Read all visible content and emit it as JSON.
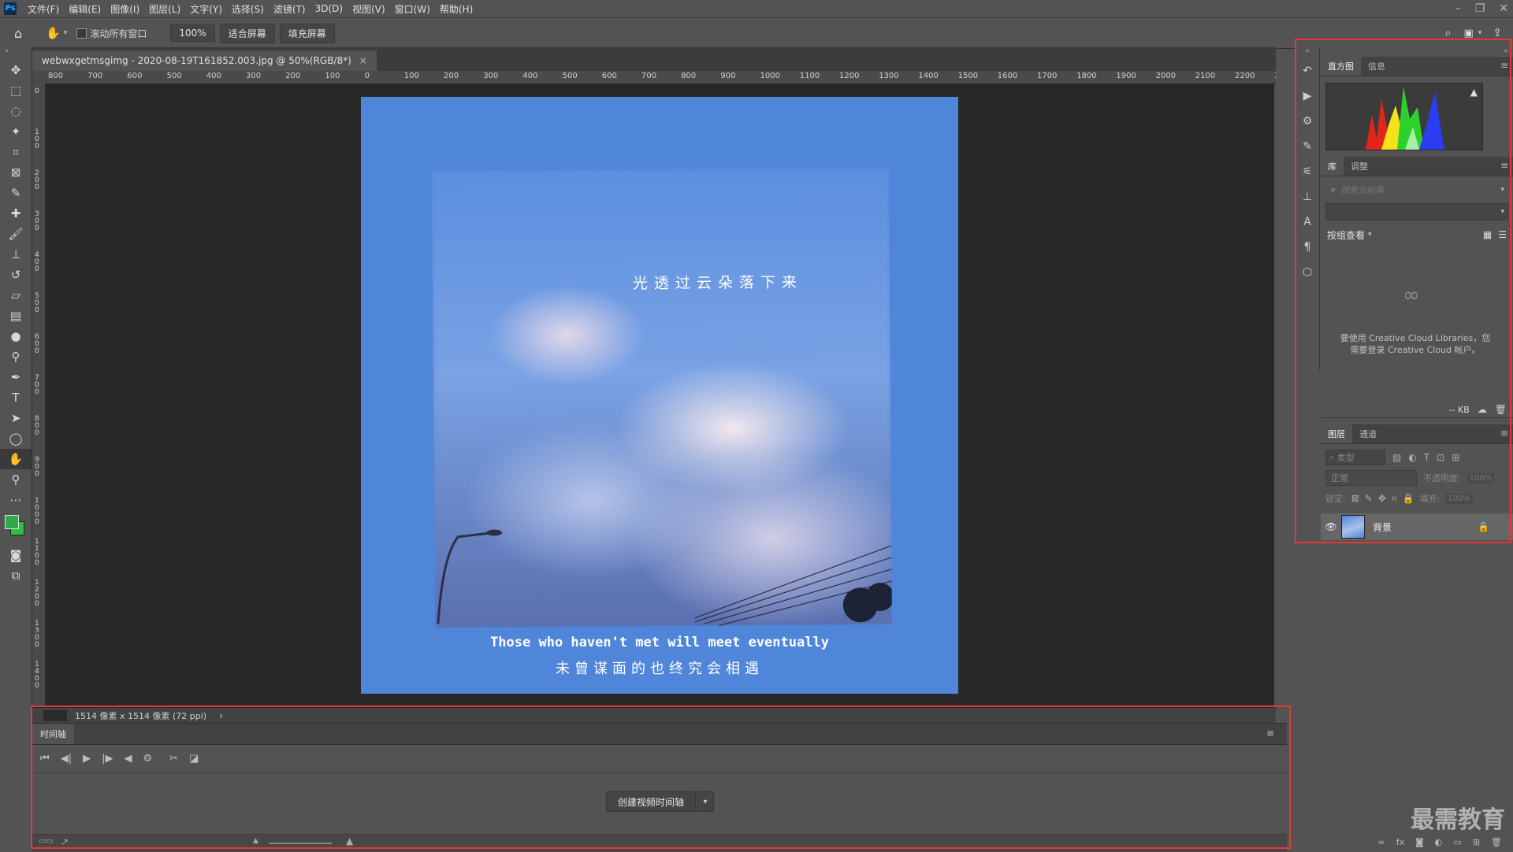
{
  "app": {
    "logo": "Ps"
  },
  "menu": [
    "文件(F)",
    "编辑(E)",
    "图像(I)",
    "图层(L)",
    "文字(Y)",
    "选择(S)",
    "滤镜(T)",
    "3D(D)",
    "视图(V)",
    "窗口(W)",
    "帮助(H)"
  ],
  "window_controls": [
    "–",
    "❐",
    "✕"
  ],
  "options": {
    "scroll_all_label": "滚动所有窗口",
    "zoom_btn": "100%",
    "fit_btn": "适合屏幕",
    "fill_btn": "填充屏幕"
  },
  "tools": [
    "move-tool-icon",
    "marquee-tool-icon",
    "lasso-tool-icon",
    "magic-wand-icon",
    "crop-tool-icon",
    "frame-tool-icon",
    "eyedropper-icon",
    "healing-brush-icon",
    "brush-tool-icon",
    "stamp-tool-icon",
    "history-brush-icon",
    "eraser-icon",
    "gradient-tool-icon",
    "blur-tool-icon",
    "dodge-tool-icon",
    "pen-tool-icon",
    "type-tool-icon",
    "path-select-icon",
    "ellipse-tool-icon",
    "hand-tool-icon",
    "zoom-tool-icon",
    "more-tools-icon"
  ],
  "colors": {
    "foreground": "#2fa84f",
    "background": "#27c43a",
    "highlight": "#e53935",
    "canvas_bg": "#4f86d9"
  },
  "document": {
    "tab_title": "webwxgetmsgimg - 2020-08-19T161852.003.jpg @ 50%(RGB/8*)",
    "tab_close": "×",
    "photo_caption": "光透过云朵落下来",
    "caption_en": "Those who haven't met will meet eventually",
    "caption_cn": "未曾谋面的也终究会相遇"
  },
  "ruler_h": [
    "800",
    "700",
    "600",
    "500",
    "400",
    "300",
    "200",
    "100",
    "0",
    "100",
    "200",
    "300",
    "400",
    "500",
    "600",
    "700",
    "800",
    "900",
    "1000",
    "1100",
    "1200",
    "1300",
    "1400",
    "1500",
    "1600",
    "1700",
    "1800",
    "1900",
    "2000",
    "2100",
    "2200",
    "2"
  ],
  "ruler_v": [
    "0",
    "1 0 0",
    "2 0 0",
    "3 0 0",
    "4 0 0",
    "5 0 0",
    "6 0 0",
    "7 0 0",
    "8 0 0",
    "9 0 0",
    "1 0 0 0",
    "1 1 0 0",
    "1 2 0 0",
    "1 3 0 0",
    "1 4 0 0"
  ],
  "status": {
    "dimensions": "1514 像素 x 1514 像素 (72 ppi)",
    "arrow": "›"
  },
  "timeline": {
    "tab": "时间轴",
    "create_btn": "创建视频时间轴",
    "controls": [
      "first-frame-icon",
      "prev-frame-icon",
      "play-icon",
      "next-frame-icon",
      "audio-icon",
      "settings-icon",
      "scissors-icon",
      "transition-icon"
    ]
  },
  "panels": {
    "histogram_tabs": [
      "直方图",
      "信息"
    ],
    "library_tabs": [
      "库",
      "调整"
    ],
    "library_search_placeholder": "搜索当前库",
    "group_by": "按组查看",
    "cc_message_1": "要使用 Creative Cloud Libraries，您",
    "cc_message_2": "需要登录 Creative Cloud 帐户。",
    "size": "-- KB",
    "layer_tabs": [
      "图层",
      "通道"
    ],
    "layer_filter": "类型",
    "blend_mode": "正常",
    "opacity_label": "不透明度:",
    "opacity_value": "100%",
    "lock_label": "锁定:",
    "fill_label": "填充:",
    "fill_value": "100%",
    "layer_name": "背景",
    "bottom_icons": [
      "link-icon",
      "fx-icon",
      "mask-icon",
      "adjustment-icon",
      "folder-icon",
      "new-layer-icon",
      "trash-icon"
    ]
  },
  "watermark": "最需教育"
}
